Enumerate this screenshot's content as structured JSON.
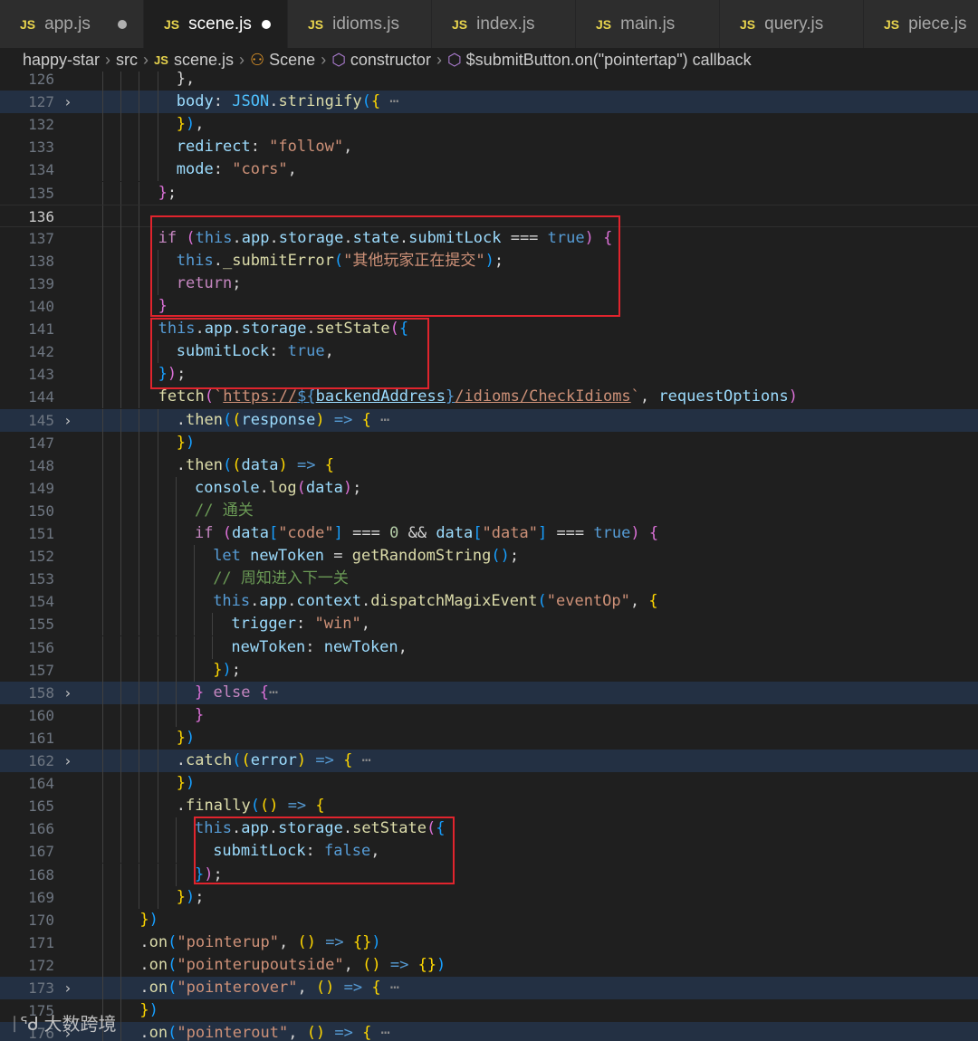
{
  "tabs": [
    {
      "label": "app.js",
      "active": false,
      "dirty": true
    },
    {
      "label": "scene.js",
      "active": true,
      "dirty": true
    },
    {
      "label": "idioms.js",
      "active": false,
      "dirty": false
    },
    {
      "label": "index.js",
      "active": false,
      "dirty": false
    },
    {
      "label": "main.js",
      "active": false,
      "dirty": false
    },
    {
      "label": "query.js",
      "active": false,
      "dirty": false
    },
    {
      "label": "piece.js",
      "active": false,
      "dirty": false
    }
  ],
  "breadcrumb": [
    "happy-star",
    "src",
    "scene.js",
    "Scene",
    "constructor",
    "$submitButton.on(\"pointertap\") callback"
  ],
  "js_badge": "JS",
  "watermark": "大数跨境",
  "lines": [
    {
      "num": "126",
      "fold": false,
      "indent": 2,
      "code": "<span class=\"p\">},</span>"
    },
    {
      "num": "127",
      "fold": true,
      "indent": 2,
      "code": "<span class=\"v\">body</span><span class=\"p\">: </span><span class=\"cn\">JSON</span><span class=\"p\">.</span><span class=\"f\">stringify</span><span class=\"l\">(</span><span class=\"y\">{</span> <span class=\"dots\">⋯</span>"
    },
    {
      "num": "132",
      "fold": false,
      "indent": 2,
      "code": "<span class=\"y\">}</span><span class=\"l\">)</span><span class=\"p\">,</span>"
    },
    {
      "num": "133",
      "fold": false,
      "indent": 2,
      "code": "<span class=\"v\">redirect</span><span class=\"p\">: </span><span class=\"s\">\"follow\"</span><span class=\"p\">,</span>"
    },
    {
      "num": "134",
      "fold": false,
      "indent": 2,
      "code": "<span class=\"v\">mode</span><span class=\"p\">: </span><span class=\"s\">\"cors\"</span><span class=\"p\">,</span>"
    },
    {
      "num": "135",
      "fold": false,
      "indent": 1,
      "code": "<span class=\"m\">}</span><span class=\"p\">;</span>"
    },
    {
      "num": "136",
      "fold": false,
      "indent": 1,
      "active": true,
      "code": ""
    },
    {
      "num": "137",
      "fold": false,
      "indent": 1,
      "code": "<span class=\"k\">if</span> <span class=\"m\">(</span><span class=\"b\">this</span><span class=\"p\">.</span><span class=\"v\">app</span><span class=\"p\">.</span><span class=\"v\">storage</span><span class=\"p\">.</span><span class=\"v\">state</span><span class=\"p\">.</span><span class=\"v\">submitLock</span> <span class=\"p\">===</span> <span class=\"b\">true</span><span class=\"m\">)</span> <span class=\"m\">{</span>"
    },
    {
      "num": "138",
      "fold": false,
      "indent": 2,
      "code": "<span class=\"b\">this</span><span class=\"p\">.</span><span class=\"f\">_submitError</span><span class=\"l\">(</span><span class=\"s\">\"其他玩家正在提交\"</span><span class=\"l\">)</span><span class=\"p\">;</span>"
    },
    {
      "num": "139",
      "fold": false,
      "indent": 2,
      "code": "<span class=\"k\">return</span><span class=\"p\">;</span>"
    },
    {
      "num": "140",
      "fold": false,
      "indent": 1,
      "code": "<span class=\"m\">}</span>"
    },
    {
      "num": "141",
      "fold": false,
      "indent": 1,
      "code": "<span class=\"b\">this</span><span class=\"p\">.</span><span class=\"v\">app</span><span class=\"p\">.</span><span class=\"v\">storage</span><span class=\"p\">.</span><span class=\"f\">setState</span><span class=\"m\">(</span><span class=\"l\">{</span>"
    },
    {
      "num": "142",
      "fold": false,
      "indent": 2,
      "code": "<span class=\"v\">submitLock</span><span class=\"p\">: </span><span class=\"b\">true</span><span class=\"p\">,</span>"
    },
    {
      "num": "143",
      "fold": false,
      "indent": 1,
      "code": "<span class=\"l\">}</span><span class=\"m\">)</span><span class=\"p\">;</span>"
    },
    {
      "num": "144",
      "fold": false,
      "indent": 1,
      "code": "<span class=\"f\">fetch</span><span class=\"m\">(</span><span class=\"s\">`</span><span class=\"s u\">https://</span><span class=\"b u\">${</span><span class=\"v u\">backendAddress</span><span class=\"b u\">}</span><span class=\"s u\">/idioms/CheckIdioms</span><span class=\"s\">`</span><span class=\"p\">, </span><span class=\"v\">requestOptions</span><span class=\"m\">)</span>"
    },
    {
      "num": "145",
      "fold": true,
      "indent": 2,
      "code": "<span class=\"p\">.</span><span class=\"f\">then</span><span class=\"l\">(</span><span class=\"y\">(</span><span class=\"v\">response</span><span class=\"y\">)</span> <span class=\"b\">=&gt;</span> <span class=\"y\">{</span> <span class=\"dots\">⋯</span>"
    },
    {
      "num": "147",
      "fold": false,
      "indent": 2,
      "code": "<span class=\"y\">}</span><span class=\"l\">)</span>"
    },
    {
      "num": "148",
      "fold": false,
      "indent": 2,
      "code": "<span class=\"p\">.</span><span class=\"f\">then</span><span class=\"l\">(</span><span class=\"y\">(</span><span class=\"v\">data</span><span class=\"y\">)</span> <span class=\"b\">=&gt;</span> <span class=\"y\">{</span>"
    },
    {
      "num": "149",
      "fold": false,
      "indent": 3,
      "code": "<span class=\"v\">console</span><span class=\"p\">.</span><span class=\"f\">log</span><span class=\"m\">(</span><span class=\"v\">data</span><span class=\"m\">)</span><span class=\"p\">;</span>"
    },
    {
      "num": "150",
      "fold": false,
      "indent": 3,
      "code": "<span class=\"c\">// 通关</span>"
    },
    {
      "num": "151",
      "fold": false,
      "indent": 3,
      "code": "<span class=\"k\">if</span> <span class=\"m\">(</span><span class=\"v\">data</span><span class=\"l\">[</span><span class=\"s\">\"code\"</span><span class=\"l\">]</span> <span class=\"p\">===</span> <span class=\"n\">0</span> <span class=\"p\">&amp;&amp;</span> <span class=\"v\">data</span><span class=\"l\">[</span><span class=\"s\">\"data\"</span><span class=\"l\">]</span> <span class=\"p\">===</span> <span class=\"b\">true</span><span class=\"m\">)</span> <span class=\"m\">{</span>"
    },
    {
      "num": "152",
      "fold": false,
      "indent": 4,
      "code": "<span class=\"b\">let</span> <span class=\"v\">newToken</span> <span class=\"p\">=</span> <span class=\"f\">getRandomString</span><span class=\"l\">()</span><span class=\"p\">;</span>"
    },
    {
      "num": "153",
      "fold": false,
      "indent": 4,
      "code": "<span class=\"c\">// 周知进入下一关</span>"
    },
    {
      "num": "154",
      "fold": false,
      "indent": 4,
      "code": "<span class=\"b\">this</span><span class=\"p\">.</span><span class=\"v\">app</span><span class=\"p\">.</span><span class=\"v\">context</span><span class=\"p\">.</span><span class=\"f\">dispatchMagixEvent</span><span class=\"l\">(</span><span class=\"s\">\"eventOp\"</span><span class=\"p\">, </span><span class=\"y\">{</span>"
    },
    {
      "num": "155",
      "fold": false,
      "indent": 5,
      "code": "<span class=\"v\">trigger</span><span class=\"p\">: </span><span class=\"s\">\"win\"</span><span class=\"p\">,</span>"
    },
    {
      "num": "156",
      "fold": false,
      "indent": 5,
      "code": "<span class=\"v\">newToken</span><span class=\"p\">: </span><span class=\"v\">newToken</span><span class=\"p\">,</span>"
    },
    {
      "num": "157",
      "fold": false,
      "indent": 4,
      "code": "<span class=\"y\">}</span><span class=\"l\">)</span><span class=\"p\">;</span>"
    },
    {
      "num": "158",
      "fold": true,
      "indent": 3,
      "code": "<span class=\"m\">}</span> <span class=\"k\">else</span> <span class=\"m\">{</span><span class=\"dots\">⋯</span>"
    },
    {
      "num": "160",
      "fold": false,
      "indent": 3,
      "code": "<span class=\"m\">}</span>"
    },
    {
      "num": "161",
      "fold": false,
      "indent": 2,
      "code": "<span class=\"y\">}</span><span class=\"l\">)</span>"
    },
    {
      "num": "162",
      "fold": true,
      "indent": 2,
      "code": "<span class=\"p\">.</span><span class=\"f\">catch</span><span class=\"l\">(</span><span class=\"y\">(</span><span class=\"v\">error</span><span class=\"y\">)</span> <span class=\"b\">=&gt;</span> <span class=\"y\">{</span> <span class=\"dots\">⋯</span>"
    },
    {
      "num": "164",
      "fold": false,
      "indent": 2,
      "code": "<span class=\"y\">}</span><span class=\"l\">)</span>"
    },
    {
      "num": "165",
      "fold": false,
      "indent": 2,
      "code": "<span class=\"p\">.</span><span class=\"f\">finally</span><span class=\"l\">(</span><span class=\"y\">()</span> <span class=\"b\">=&gt;</span> <span class=\"y\">{</span>"
    },
    {
      "num": "166",
      "fold": false,
      "indent": 3,
      "code": "<span class=\"b\">this</span><span class=\"p\">.</span><span class=\"v\">app</span><span class=\"p\">.</span><span class=\"v\">storage</span><span class=\"p\">.</span><span class=\"f\">setState</span><span class=\"m\">(</span><span class=\"l\">{</span>"
    },
    {
      "num": "167",
      "fold": false,
      "indent": 4,
      "code": "<span class=\"v\">submitLock</span><span class=\"p\">: </span><span class=\"b\">false</span><span class=\"p\">,</span>"
    },
    {
      "num": "168",
      "fold": false,
      "indent": 3,
      "code": "<span class=\"l\">}</span><span class=\"m\">)</span><span class=\"p\">;</span>"
    },
    {
      "num": "169",
      "fold": false,
      "indent": 2,
      "code": "<span class=\"y\">}</span><span class=\"l\">)</span><span class=\"p\">;</span>"
    },
    {
      "num": "170",
      "fold": false,
      "indent": 0,
      "code": "<span class=\"y\">}</span><span class=\"l\">)</span>"
    },
    {
      "num": "171",
      "fold": false,
      "indent": 0,
      "code": "<span class=\"p\">.</span><span class=\"f\">on</span><span class=\"l\">(</span><span class=\"s\">\"pointerup\"</span><span class=\"p\">, </span><span class=\"y\">()</span> <span class=\"b\">=&gt;</span> <span class=\"y\">{}</span><span class=\"l\">)</span>"
    },
    {
      "num": "172",
      "fold": false,
      "indent": 0,
      "code": "<span class=\"p\">.</span><span class=\"f\">on</span><span class=\"l\">(</span><span class=\"s\">\"pointerupoutside\"</span><span class=\"p\">, </span><span class=\"y\">()</span> <span class=\"b\">=&gt;</span> <span class=\"y\">{}</span><span class=\"l\">)</span>"
    },
    {
      "num": "173",
      "fold": true,
      "indent": 0,
      "code": "<span class=\"p\">.</span><span class=\"f\">on</span><span class=\"l\">(</span><span class=\"s\">\"pointerover\"</span><span class=\"p\">, </span><span class=\"y\">()</span> <span class=\"b\">=&gt;</span> <span class=\"y\">{</span> <span class=\"dots\">⋯</span>"
    },
    {
      "num": "175",
      "fold": false,
      "indent": 0,
      "code": "<span class=\"y\">}</span><span class=\"l\">)</span>"
    },
    {
      "num": "176",
      "fold": true,
      "indent": 0,
      "code": "<span class=\"p\">.</span><span class=\"f\">on</span><span class=\"l\">(</span><span class=\"s\">\"pointerout\"</span><span class=\"p\">, </span><span class=\"y\">()</span> <span class=\"b\">=&gt;</span> <span class=\"y\">{</span> <span class=\"dots\">⋯</span>"
    }
  ]
}
